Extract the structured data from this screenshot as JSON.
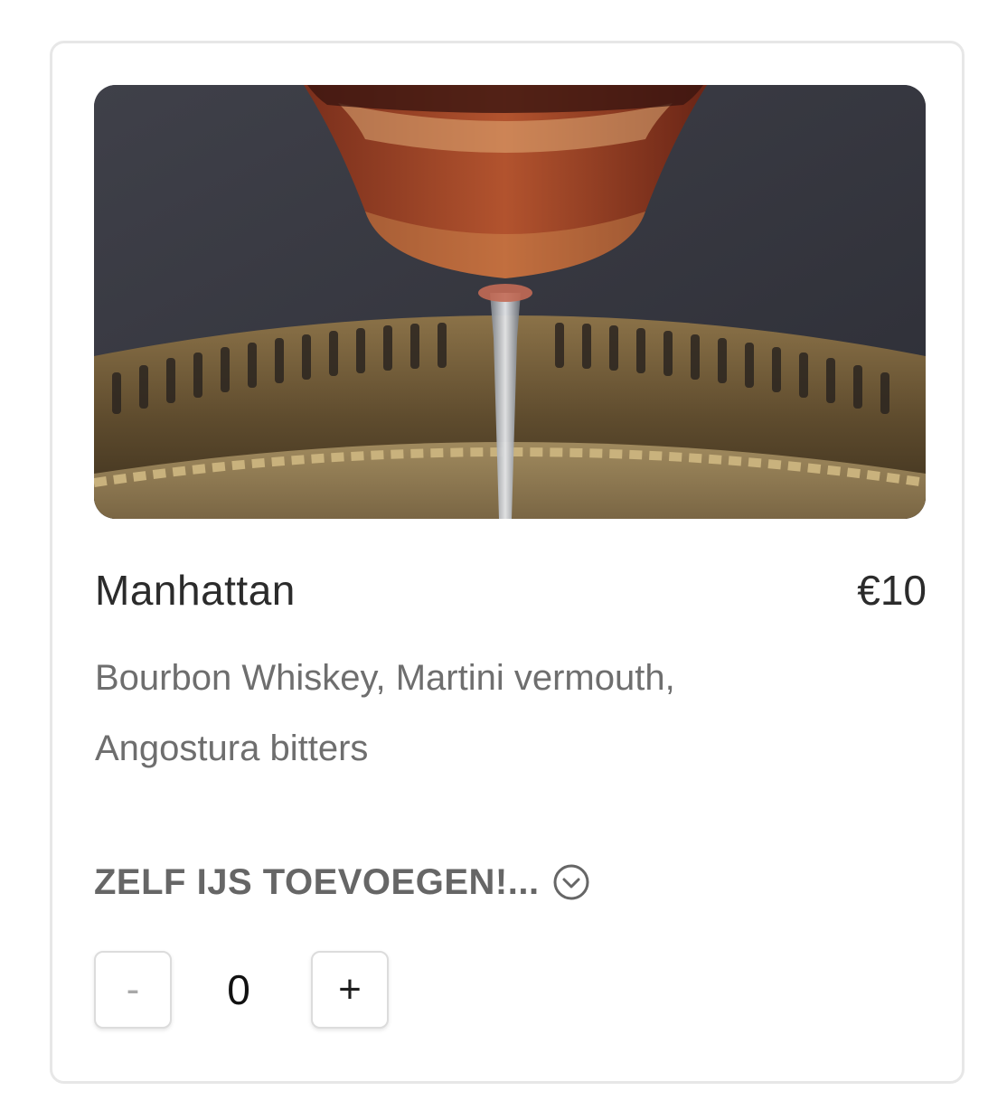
{
  "product": {
    "image_alt": "Manhattan cocktail on a brass tray",
    "name": "Manhattan",
    "price": "€10",
    "description": "Bourbon Whiskey, Martini vermouth, Angostura bitters"
  },
  "options": {
    "label": "ZELF IJS TOEVOEGEN!...",
    "icon": "chevron-down-circle-icon"
  },
  "quantity": {
    "decrement_label": "-",
    "value": "0",
    "increment_label": "+"
  },
  "colors": {
    "title_text": "#2b2b2b",
    "secondary_text": "#6e6e6e",
    "card_border": "#e7e7e7"
  }
}
